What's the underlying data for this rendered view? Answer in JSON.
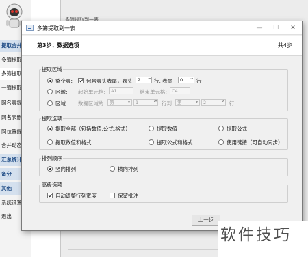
{
  "background": {
    "sidebar": {
      "items": [
        {
          "label": "提取合并",
          "style": "head"
        },
        {
          "label": "多簿提取",
          "style": "normal"
        },
        {
          "label": "多簿提取",
          "style": "active"
        },
        {
          "label": "一簿提取",
          "style": "normal"
        },
        {
          "label": "网名表提",
          "style": "normal"
        },
        {
          "label": "网名表删",
          "style": "normal"
        },
        {
          "label": "网位置提",
          "style": "normal"
        },
        {
          "label": "合并动态",
          "style": "normal"
        },
        {
          "label": "汇总统计",
          "style": "head"
        },
        {
          "label": "备分",
          "style": "head"
        },
        {
          "label": "其他",
          "style": "head"
        },
        {
          "label": "系统设置",
          "style": "normal"
        },
        {
          "label": "退出",
          "style": "normal"
        }
      ]
    },
    "main_tab": "多簿提取到一表"
  },
  "dialog": {
    "title": "多簿提取到一表",
    "step_title": "第3步：数据选项",
    "step_count": "共4步",
    "extract_range": {
      "label": "提取区域",
      "whole_table": {
        "label": "整个表:",
        "selected": true,
        "include_header_tail": {
          "label": "包含表头表尾，表头",
          "checked": true
        },
        "header_rows": "2",
        "rows_tail_label": "行, 表尾",
        "tail_rows": "0",
        "rows_end_label": "行"
      },
      "region": {
        "label": "区域:",
        "selected": false,
        "start_label": "起始单元格:",
        "start_value": "A1",
        "end_label": "结束单元格:",
        "end_value": "C4"
      },
      "region2": {
        "label": "区域:",
        "selected": false,
        "data_label": "数据区域的",
        "combo1": "第",
        "spin1": "1",
        "row_to_label": "行到",
        "combo2": "第",
        "spin2": "2",
        "row_label": "行"
      }
    },
    "extract_options": {
      "label": "提取选项",
      "items": [
        {
          "label": "提取全部（包括数值,公式,格式）",
          "selected": true
        },
        {
          "label": "提取数值",
          "selected": false
        },
        {
          "label": "提取公式",
          "selected": false
        },
        {
          "label": "提取数值和格式",
          "selected": false
        },
        {
          "label": "提取公式和格式",
          "selected": false
        },
        {
          "label": "使用链接（可自动同步）",
          "selected": false
        }
      ]
    },
    "arrange": {
      "label": "排列顺序",
      "items": [
        {
          "label": "竖向排列",
          "selected": true
        },
        {
          "label": "横向排列",
          "selected": false
        }
      ]
    },
    "advanced": {
      "label": "高级选项",
      "auto_width": {
        "label": "自动调整行列宽度",
        "checked": true
      },
      "keep_comments": {
        "label": "保留批注",
        "checked": false
      }
    },
    "prev_button": "上一步"
  },
  "watermark": "软件技巧"
}
